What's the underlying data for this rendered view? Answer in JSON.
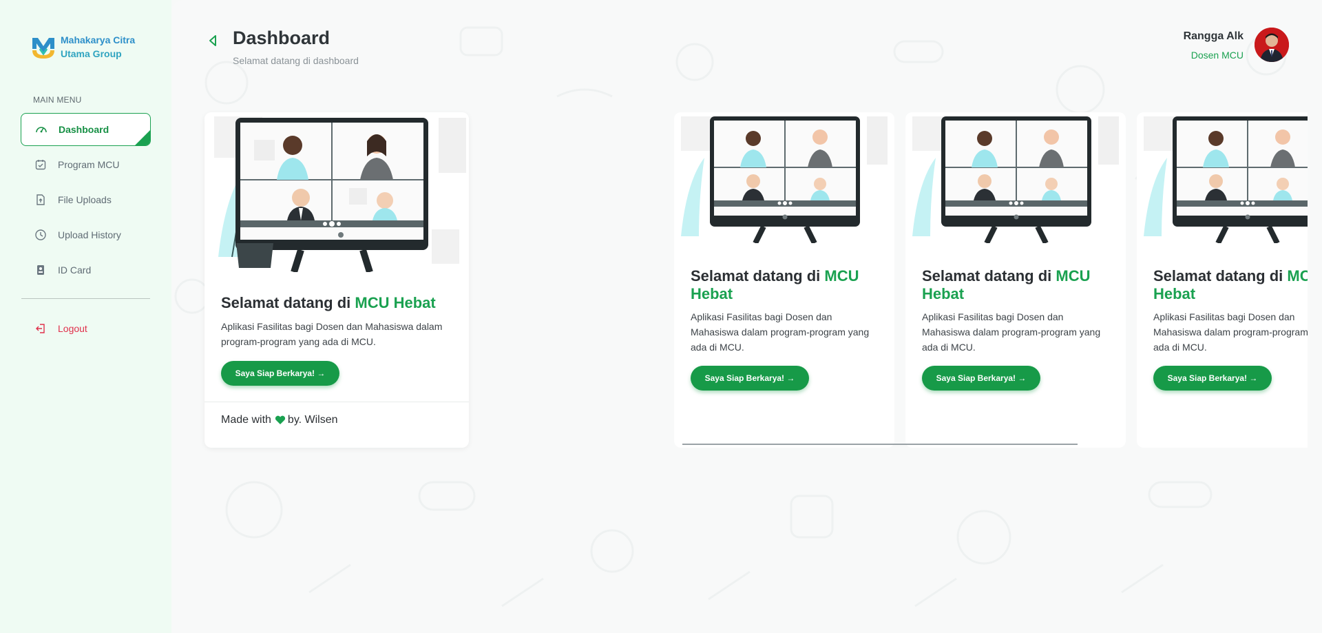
{
  "brand": {
    "line1": "Mahakarya Citra",
    "line2": "Utama Group"
  },
  "sidebar": {
    "section_title": "MAIN MENU",
    "items": [
      {
        "label": "Dashboard",
        "icon": "speedometer-icon",
        "active": true
      },
      {
        "label": "Program MCU",
        "icon": "calendar-check-icon",
        "active": false
      },
      {
        "label": "File Uploads",
        "icon": "file-upload-icon",
        "active": false
      },
      {
        "label": "Upload History",
        "icon": "clock-icon",
        "active": false
      },
      {
        "label": "ID Card",
        "icon": "id-card-icon",
        "active": false
      }
    ],
    "logout_label": "Logout"
  },
  "header": {
    "title": "Dashboard",
    "subtitle": "Selamat datang di dashboard"
  },
  "user": {
    "name": "Rangga Alk",
    "role": "Dosen MCU"
  },
  "welcome_card": {
    "title_prefix": "Selamat datang di ",
    "title_highlight": "MCU Hebat",
    "description": "Aplikasi Fasilitas bagi Dosen dan Mahasiswa dalam program-program yang ada di MCU.",
    "button_label": "Saya Siap Berkarya! →",
    "footer_prefix": "Made with",
    "footer_suffix": "by. Wilsen"
  },
  "slides": [
    {
      "title_prefix": "Selamat datang di ",
      "title_highlight_1": "MCU",
      "title_highlight_2": "Hebat",
      "description": "Aplikasi Fasilitas bagi Dosen dan Mahasiswa dalam program-program yang ada di MCU.",
      "button_label": "Saya Siap Berkarya! →"
    },
    {
      "title_prefix": "Selamat datang di ",
      "title_highlight_1": "MCU",
      "title_highlight_2": "Hebat",
      "description": "Aplikasi Fasilitas bagi Dosen dan Mahasiswa dalam program-program yang ada di MCU.",
      "button_label": "Saya Siap Berkarya! →"
    },
    {
      "title_prefix": "Selamat datang di ",
      "title_highlight_1": "MCU",
      "title_highlight_2": "Hebat",
      "description": "Aplikasi Fasilitas bagi Dosen dan Mahasiswa dalam program-program yang ada di MCU.",
      "button_label": "Saya Siap Berkarya! →"
    }
  ],
  "colors": {
    "accent": "#1aa150",
    "danger": "#e0304b",
    "sidebar_bg": "#effbf3"
  }
}
